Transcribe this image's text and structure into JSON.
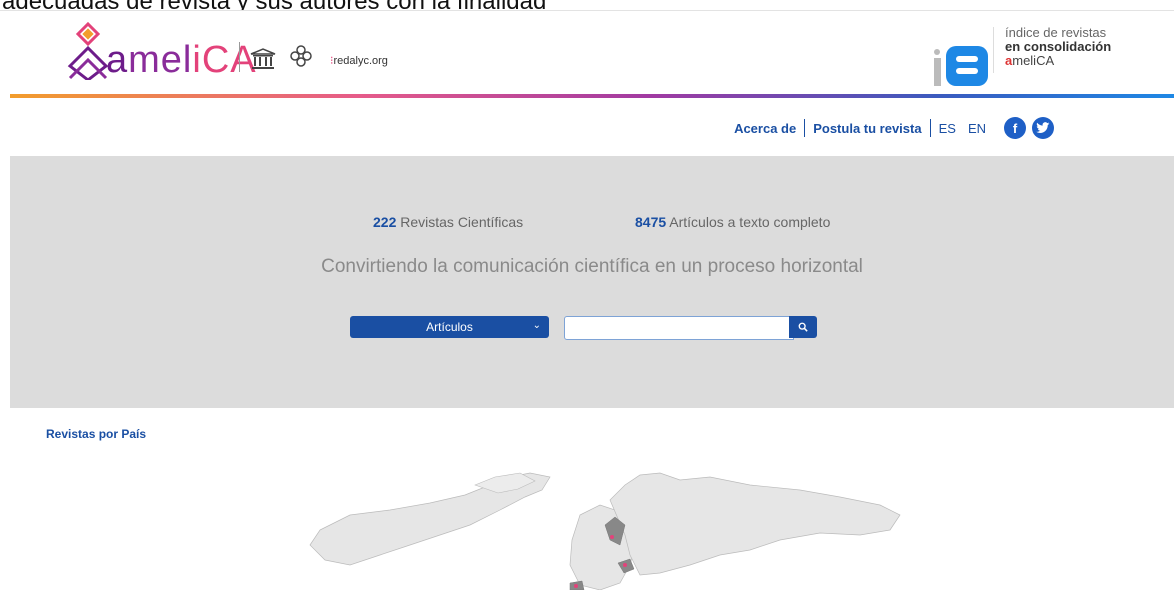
{
  "cropped_text": "adecuadas de revista y sus autores con la finalidad",
  "header": {
    "amelica_logo": "ameliCA",
    "unesco_label": "UNESCO",
    "clacso_label": "CLACSO",
    "redalyc_label": "redalyc.org",
    "ia_line1": "índice de revistas",
    "ia_line2": "en consolidación",
    "ia_line3": "ameliCA"
  },
  "nav": {
    "about": "Acerca de",
    "apply": "Postula tu revista",
    "lang_es": "ES",
    "lang_en": "EN",
    "facebook": "f",
    "twitter": "t"
  },
  "hero": {
    "journals_count": "222",
    "journals_label": "Revistas Científicas",
    "articles_count": "8475",
    "articles_label": "Artículos a texto completo",
    "tagline": "Convirtiendo la comunicación científica en un proceso horizontal",
    "search_type": "Artículos",
    "search_value": ""
  },
  "section": {
    "countries_title": "Revistas por País"
  },
  "colors": {
    "primary": "#1a4fa3",
    "hero_bg": "#dcdcdc",
    "accent_pink": "#e3427a"
  }
}
